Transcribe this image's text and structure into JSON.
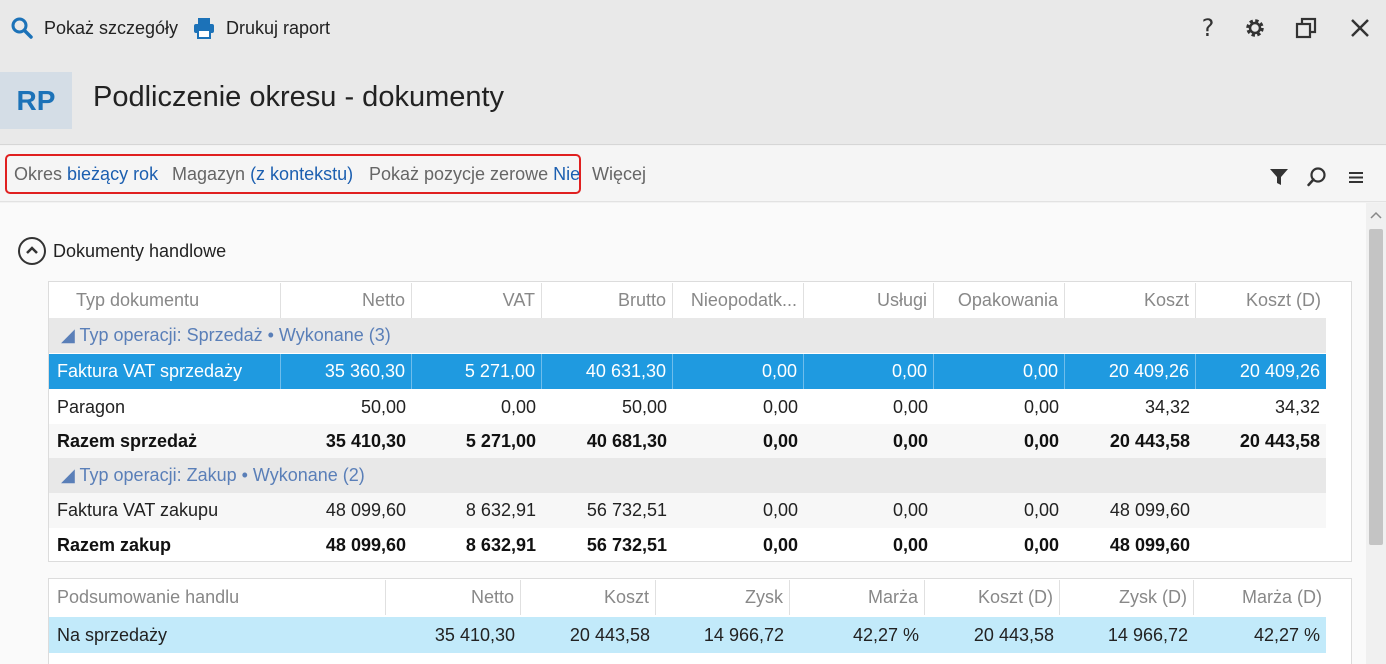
{
  "toolbar": {
    "show_details": "Pokaż szczegóły",
    "print_report": "Drukuj raport"
  },
  "header": {
    "badge": "RP",
    "title": "Podliczenie okresu - dokumenty"
  },
  "filters": {
    "period_label": "Okres",
    "period_value": "bieżący rok",
    "warehouse_label": "Magazyn",
    "warehouse_value": "(z kontekstu)",
    "zero_label": "Pokaż pozycje zerowe",
    "zero_value": "Nie",
    "more": "Więcej"
  },
  "section": {
    "title": "Dokumenty handlowe"
  },
  "trade_table": {
    "columns": [
      "Typ dokumentu",
      "Netto",
      "VAT",
      "Brutto",
      "Nieopodatk...",
      "Usługi",
      "Opakowania",
      "Koszt",
      "Koszt (D)"
    ],
    "group_sales": "◢ Typ operacji: Sprzedaż • Wykonane (3)",
    "rows_sales": [
      [
        "Faktura VAT sprzedaży",
        "35 360,30",
        "5 271,00",
        "40 631,30",
        "0,00",
        "0,00",
        "0,00",
        "20 409,26",
        "20 409,26"
      ],
      [
        "Paragon",
        "50,00",
        "0,00",
        "50,00",
        "0,00",
        "0,00",
        "0,00",
        "34,32",
        "34,32"
      ]
    ],
    "total_sales": [
      "Razem sprzedaż",
      "35 410,30",
      "5 271,00",
      "40 681,30",
      "0,00",
      "0,00",
      "0,00",
      "20 443,58",
      "20 443,58"
    ],
    "group_purchase": "◢ Typ operacji: Zakup • Wykonane (2)",
    "rows_purchase": [
      [
        "Faktura VAT zakupu",
        "48 099,60",
        "8 632,91",
        "56 732,51",
        "0,00",
        "0,00",
        "0,00",
        "48 099,60",
        ""
      ]
    ],
    "total_purchase": [
      "Razem zakup",
      "48 099,60",
      "8 632,91",
      "56 732,51",
      "0,00",
      "0,00",
      "0,00",
      "48 099,60",
      ""
    ]
  },
  "summary_table": {
    "columns": [
      "Podsumowanie handlu",
      "Netto",
      "Koszt",
      "Zysk",
      "Marża",
      "Koszt (D)",
      "Zysk (D)",
      "Marża (D)"
    ],
    "rows": [
      [
        "Na sprzedaży",
        "35 410,30",
        "20 443,58",
        "14 966,72",
        "42,27 %",
        "20 443,58",
        "14 966,72",
        "42,27 %"
      ]
    ]
  },
  "colors": {
    "accent": "#1c72b8",
    "selection": "#1f9ae0",
    "highlight_border": "#e02020"
  }
}
